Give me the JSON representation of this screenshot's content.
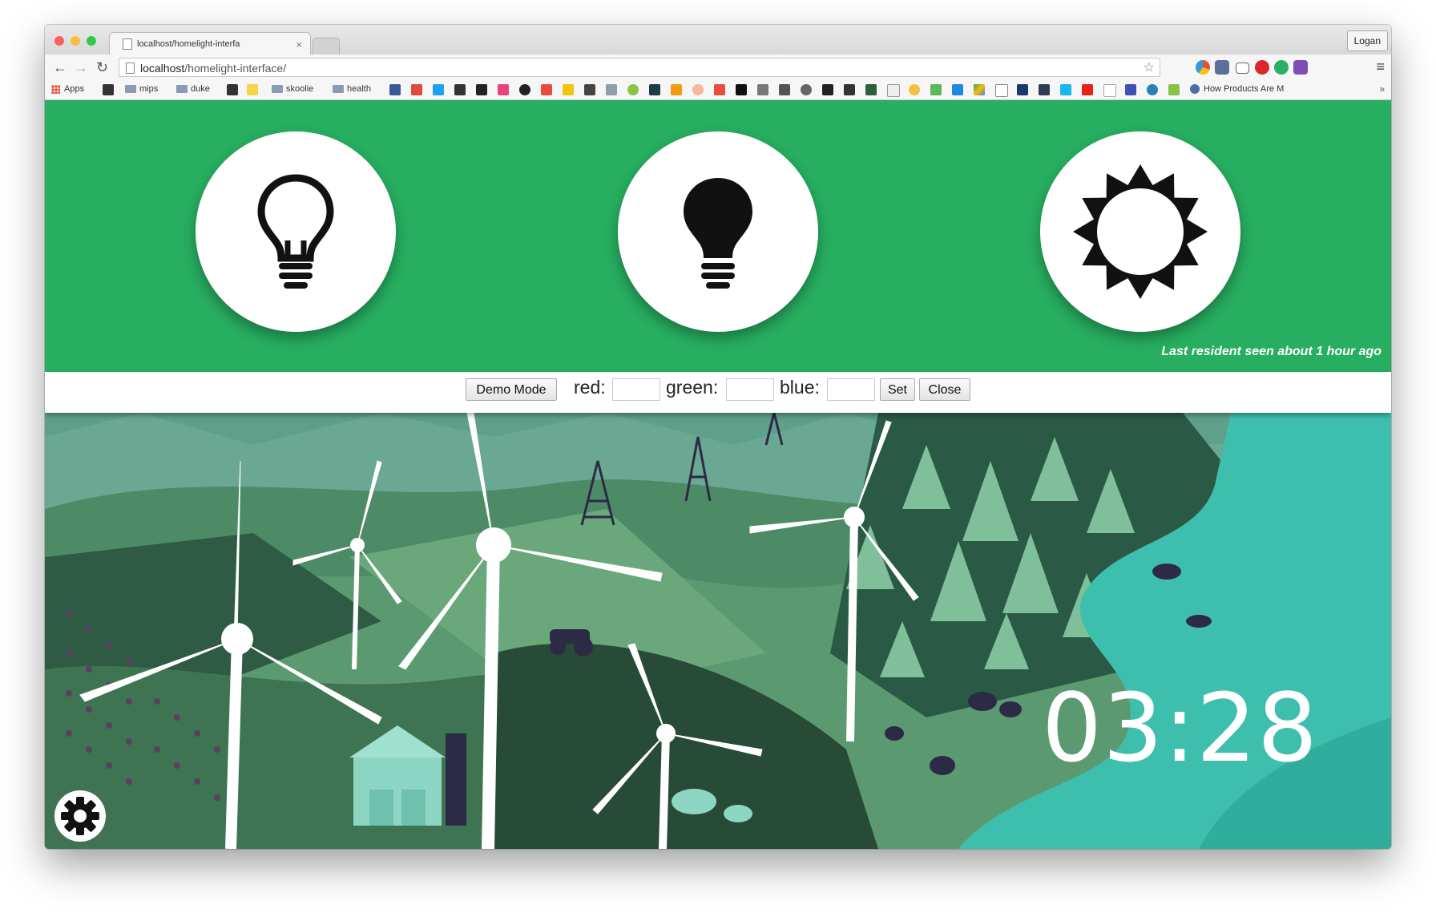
{
  "browser": {
    "tab_title": "localhost/homelight-interfa",
    "tab_close": "×",
    "profile_name": "Logan",
    "url_host": "localhost",
    "url_path": "/homelight-interface/",
    "nav": {
      "back": "←",
      "forward": "→",
      "reload": "↻",
      "star": "☆",
      "menu": "≡"
    }
  },
  "bookmarks": {
    "apps_label": "Apps",
    "folders": [
      "mips",
      "duke",
      "skoolie",
      "health"
    ],
    "last_label": "How Products Are M",
    "more": "»"
  },
  "controls": {
    "demo_mode": "Demo Mode",
    "red_label": "red:",
    "green_label": "green:",
    "blue_label": "blue:",
    "red_value": "",
    "green_value": "",
    "blue_value": "",
    "set_label": "Set",
    "close_label": "Close"
  },
  "status": {
    "last_seen": "Last resident seen about 1 hour ago"
  },
  "icons": {
    "light_off": "lightbulb-outline-icon",
    "light_on": "lightbulb-filled-icon",
    "daylight": "sun-icon",
    "settings": "gear-icon"
  },
  "colors": {
    "header_green": "#27ae60",
    "scene_dark": "#2e5e45",
    "water": "#3ebfae"
  },
  "clock": {
    "time": "03:28"
  }
}
